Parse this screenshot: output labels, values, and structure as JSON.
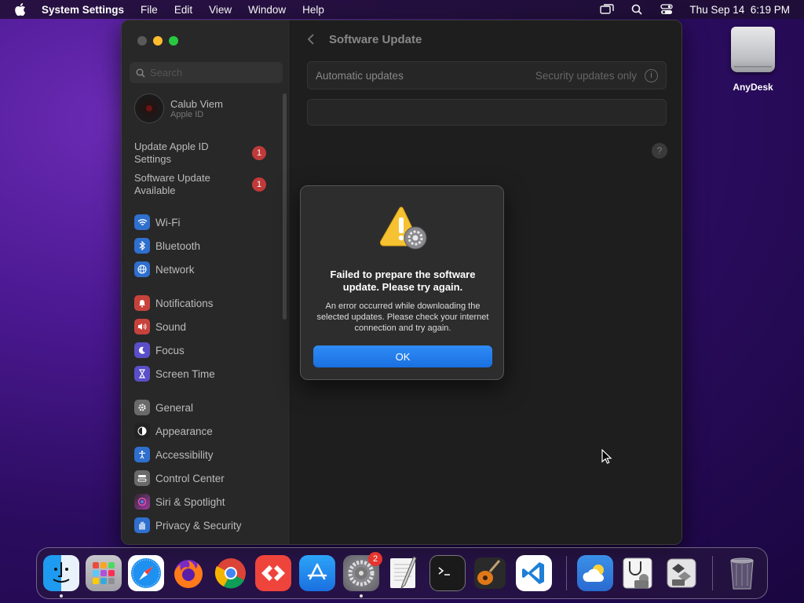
{
  "menubar": {
    "app_name": "System Settings",
    "items": [
      "File",
      "Edit",
      "View",
      "Window",
      "Help"
    ],
    "clock": "Thu Sep 14  6:19 PM"
  },
  "desktop": {
    "icon_label": "AnyDesk"
  },
  "sidebar": {
    "search_placeholder": "Search",
    "profile_name": "Calub Viem",
    "profile_sub": "Apple ID",
    "alerts": [
      {
        "label": "Update Apple ID Settings",
        "badge": "1"
      },
      {
        "label": "Software Update Available",
        "badge": "1"
      }
    ],
    "items": [
      {
        "label": "Wi-Fi",
        "icon": "wifi-icon",
        "color": "#2f6fce"
      },
      {
        "label": "Bluetooth",
        "icon": "bluetooth-icon",
        "color": "#2f6fce"
      },
      {
        "label": "Network",
        "icon": "network-icon",
        "color": "#2f6fce"
      },
      {
        "label": "Notifications",
        "icon": "bell-icon",
        "color": "#c8423c"
      },
      {
        "label": "Sound",
        "icon": "speaker-icon",
        "color": "#c8423c"
      },
      {
        "label": "Focus",
        "icon": "moon-icon",
        "color": "#5a4fc8"
      },
      {
        "label": "Screen Time",
        "icon": "hourglass-icon",
        "color": "#5a4fc8"
      },
      {
        "label": "General",
        "icon": "gear-icon",
        "color": "#6a6a6a"
      },
      {
        "label": "Appearance",
        "icon": "appearance-icon",
        "color": "#222222"
      },
      {
        "label": "Accessibility",
        "icon": "accessibility-icon",
        "color": "#2f6fce"
      },
      {
        "label": "Control Center",
        "icon": "control-center-icon",
        "color": "#6a6a6a"
      },
      {
        "label": "Siri & Spotlight",
        "icon": "siri-icon",
        "color": "#a03aa0"
      },
      {
        "label": "Privacy & Security",
        "icon": "hand-icon",
        "color": "#2f6fce"
      }
    ]
  },
  "content": {
    "title": "Software Update",
    "auto_label": "Automatic updates",
    "auto_value": "Security updates only",
    "help_glyph": "?"
  },
  "dialog": {
    "title": "Failed to prepare the software update. Please try again.",
    "body": "An error occurred while downloading the selected updates. Please check your internet connection and try again.",
    "ok_label": "OK"
  },
  "dock": {
    "settings_badge": "2"
  }
}
